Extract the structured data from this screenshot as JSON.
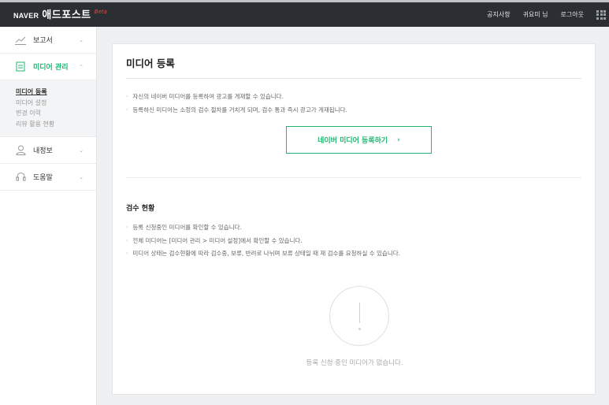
{
  "header": {
    "brand": "NAVER",
    "service": "애드포스트",
    "beta": "Beta",
    "links": [
      "공지사항",
      "귀요미 님",
      "로그아웃"
    ]
  },
  "sidebar": {
    "menus": [
      {
        "label": "보고서",
        "icon": "chart-line-icon"
      },
      {
        "label": "미디어 관리",
        "icon": "media-icon"
      },
      {
        "label": "내정보",
        "icon": "user-icon"
      },
      {
        "label": "도움말",
        "icon": "headset-icon"
      }
    ],
    "submenu": [
      "미디어 등록",
      "미디어 설정",
      "변경 이력",
      "리뷰 활용 현황"
    ]
  },
  "main": {
    "title": "미디어 등록",
    "notes": [
      "자신의 네이버 미디어를 등록하여 광고를 게재할 수 있습니다.",
      "등록하신 미디어는 소정의 검수 절차를 거치게 되며, 검수 통과 즉시 광고가 게재됩니다."
    ],
    "register_button": "네이버 미디어 등록하기",
    "register_arrow": "›",
    "review_title": "검수 현황",
    "review_notes": [
      "등록 신청중인 미디어를 확인할 수 있습니다.",
      "전체 미디어는 [미디어 관리 > 미디어 설정]에서 확인할 수 있습니다.",
      "미디어 상태는 검수현황에 따라 검수중, 보류, 반려로 나뉘며 보류 상태일 때 재 검수를 요청하실 수 있습니다."
    ],
    "empty_message": "등록 신청 중인 미디어가 없습니다."
  },
  "colors": {
    "accent": "#22b573",
    "topbar": "#2b2f33"
  }
}
